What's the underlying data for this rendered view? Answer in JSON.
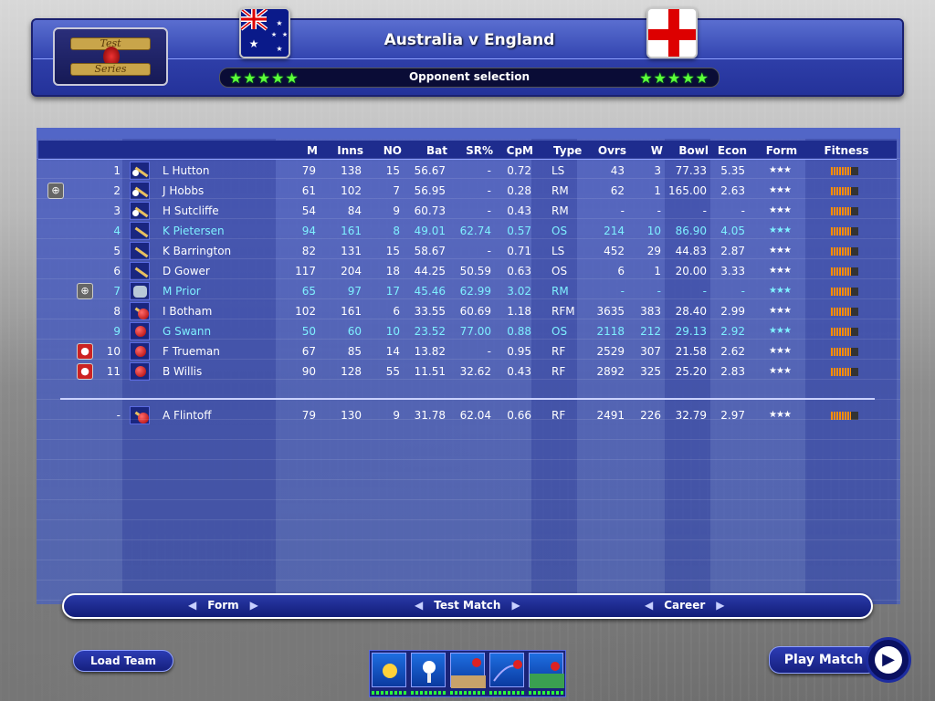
{
  "header": {
    "logo_top": "Test",
    "logo_bottom": "Series",
    "match_title": "Australia v England",
    "subtitle": "Opponent selection",
    "stars_left": "★★★★★",
    "stars_right": "★★★★★"
  },
  "columns": [
    "M",
    "Inns",
    "NO",
    "Bat",
    "SR%",
    "CpM",
    "Type",
    "Ovrs",
    "W",
    "Bowl",
    "Econ",
    "Form",
    "Fitness"
  ],
  "players": [
    {
      "num": "1",
      "name": "L Hutton",
      "m": "79",
      "inns": "138",
      "no": "15",
      "bat": "56.67",
      "sr": "-",
      "cpm": "0.72",
      "type": "LS",
      "ovrs": "43",
      "w": "3",
      "bowl": "77.33",
      "econ": "5.35",
      "icon": "bat-ball-icon",
      "color": "white",
      "cap": ""
    },
    {
      "num": "2",
      "name": "J Hobbs",
      "m": "61",
      "inns": "102",
      "no": "7",
      "bat": "56.95",
      "sr": "-",
      "cpm": "0.28",
      "type": "RM",
      "ovrs": "62",
      "w": "1",
      "bowl": "165.00",
      "econ": "2.63",
      "icon": "bat-ball-icon",
      "color": "white",
      "cap": "captain-icon"
    },
    {
      "num": "3",
      "name": "H Sutcliffe",
      "m": "54",
      "inns": "84",
      "no": "9",
      "bat": "60.73",
      "sr": "-",
      "cpm": "0.43",
      "type": "RM",
      "ovrs": "-",
      "w": "-",
      "bowl": "-",
      "econ": "-",
      "icon": "bat-ball-icon",
      "color": "white",
      "cap": ""
    },
    {
      "num": "4",
      "name": "K Pietersen",
      "m": "94",
      "inns": "161",
      "no": "8",
      "bat": "49.01",
      "sr": "62.74",
      "cpm": "0.57",
      "type": "OS",
      "ovrs": "214",
      "w": "10",
      "bowl": "86.90",
      "econ": "4.05",
      "icon": "bat-icon",
      "color": "cyan",
      "cap": ""
    },
    {
      "num": "5",
      "name": "K Barrington",
      "m": "82",
      "inns": "131",
      "no": "15",
      "bat": "58.67",
      "sr": "-",
      "cpm": "0.71",
      "type": "LS",
      "ovrs": "452",
      "w": "29",
      "bowl": "44.83",
      "econ": "2.87",
      "icon": "bat-icon",
      "color": "white",
      "cap": ""
    },
    {
      "num": "6",
      "name": "D Gower",
      "m": "117",
      "inns": "204",
      "no": "18",
      "bat": "44.25",
      "sr": "50.59",
      "cpm": "0.63",
      "type": "OS",
      "ovrs": "6",
      "w": "1",
      "bowl": "20.00",
      "econ": "3.33",
      "icon": "bat-icon",
      "color": "white",
      "cap": ""
    },
    {
      "num": "7",
      "name": "M Prior",
      "m": "65",
      "inns": "97",
      "no": "17",
      "bat": "45.46",
      "sr": "62.99",
      "cpm": "3.02",
      "type": "RM",
      "ovrs": "-",
      "w": "-",
      "bowl": "-",
      "econ": "-",
      "icon": "gloves-icon",
      "color": "cyan",
      "cap": "keeper-icon"
    },
    {
      "num": "8",
      "name": "I Botham",
      "m": "102",
      "inns": "161",
      "no": "6",
      "bat": "33.55",
      "sr": "60.69",
      "cpm": "1.18",
      "type": "RFM",
      "ovrs": "3635",
      "w": "383",
      "bowl": "28.40",
      "econ": "2.99",
      "icon": "allrounder-icon",
      "color": "white",
      "cap": ""
    },
    {
      "num": "9",
      "name": "G Swann",
      "m": "50",
      "inns": "60",
      "no": "10",
      "bat": "23.52",
      "sr": "77.00",
      "cpm": "0.88",
      "type": "OS",
      "ovrs": "2118",
      "w": "212",
      "bowl": "29.13",
      "econ": "2.92",
      "icon": "ball-icon",
      "color": "cyan",
      "cap": ""
    },
    {
      "num": "10",
      "name": "F Trueman",
      "m": "67",
      "inns": "85",
      "no": "14",
      "bat": "13.82",
      "sr": "-",
      "cpm": "0.95",
      "type": "RF",
      "ovrs": "2529",
      "w": "307",
      "bowl": "21.58",
      "econ": "2.62",
      "icon": "ball-icon",
      "color": "white",
      "cap": "new-ball-icon"
    },
    {
      "num": "11",
      "name": "B Willis",
      "m": "90",
      "inns": "128",
      "no": "55",
      "bat": "11.51",
      "sr": "32.62",
      "cpm": "0.43",
      "type": "RF",
      "ovrs": "2892",
      "w": "325",
      "bowl": "25.20",
      "econ": "2.83",
      "icon": "ball-icon",
      "color": "white",
      "cap": "new-ball-icon"
    }
  ],
  "reserve": {
    "num": "-",
    "name": "A Flintoff",
    "m": "79",
    "inns": "130",
    "no": "9",
    "bat": "31.78",
    "sr": "62.04",
    "cpm": "0.66",
    "type": "RF",
    "ovrs": "2491",
    "w": "226",
    "bowl": "32.79",
    "econ": "2.97",
    "icon": "allrounder-icon",
    "color": "white"
  },
  "form_stars": "★★★",
  "nav": {
    "form": "Form",
    "test_match": "Test Match",
    "career": "Career",
    "left_arrow": "◀",
    "right_arrow": "▶"
  },
  "buttons": {
    "load_team": "Load Team",
    "play_match": "Play Match",
    "play_glyph": "▶"
  },
  "tools": [
    "sun-icon",
    "ball-on-tee-icon",
    "pitch-icon",
    "bowling-icon",
    "field-icon"
  ]
}
